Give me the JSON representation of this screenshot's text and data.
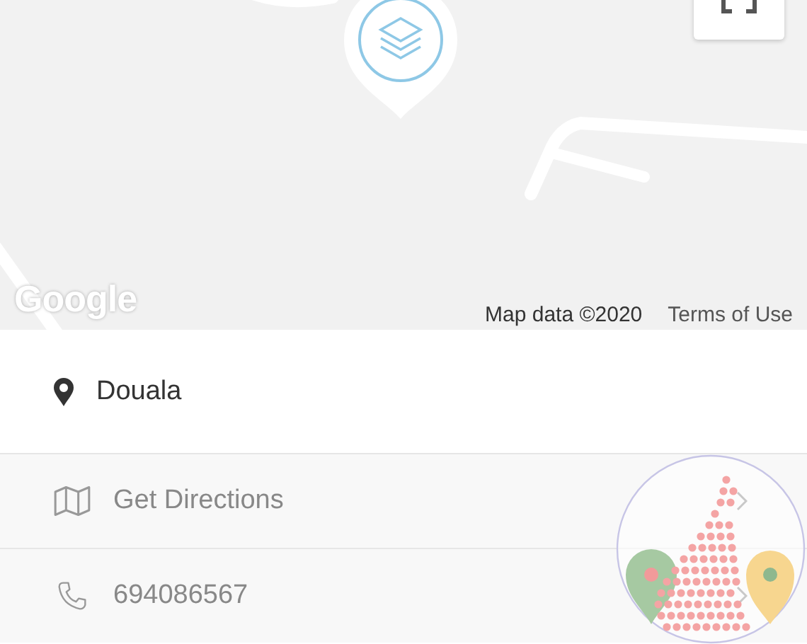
{
  "map": {
    "logo": "Google",
    "attribution": "Map data ©2020",
    "terms_link": "Terms of Use"
  },
  "location": {
    "label": "Douala"
  },
  "actions": [
    {
      "kind": "directions",
      "label": "Get Directions"
    },
    {
      "kind": "phone",
      "label": "694086567"
    }
  ]
}
